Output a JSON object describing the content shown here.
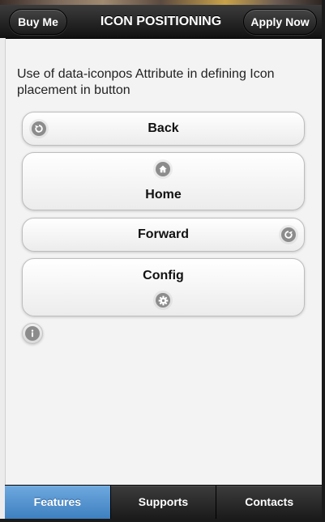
{
  "header": {
    "title": "ICON POSITIONING",
    "left_button": "Buy Me",
    "right_button": "Apply Now"
  },
  "content": {
    "intro": "Use of data-iconpos Attribute in defining Icon placement in button",
    "buttons": [
      {
        "label": "Back",
        "icon": "back-icon",
        "iconpos": "left"
      },
      {
        "label": "Home",
        "icon": "home-icon",
        "iconpos": "top"
      },
      {
        "label": "Forward",
        "icon": "forward-icon",
        "iconpos": "right"
      },
      {
        "label": "Config",
        "icon": "gear-icon",
        "iconpos": "bottom"
      }
    ],
    "icon_only_button": {
      "icon": "info-icon",
      "iconpos": "notext"
    }
  },
  "navbar": {
    "tabs": [
      {
        "label": "Features",
        "active": true
      },
      {
        "label": "Supports",
        "active": false
      },
      {
        "label": "Contacts",
        "active": false
      }
    ]
  },
  "colors": {
    "header_bg": "#1c1c1c",
    "active_tab": "#4a8fcf",
    "icon_disc": "#8c8c8c",
    "page_bg": "#f3f3f3"
  }
}
